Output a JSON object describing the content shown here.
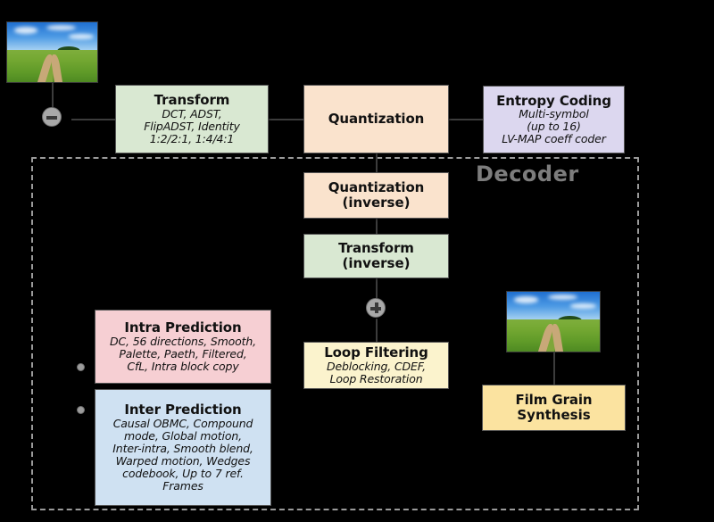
{
  "diagram": {
    "region_label": "Decoder",
    "nodes": [
      {
        "id": "transform",
        "title": "Transform",
        "sub": "DCT, ADST,\nFlipADST, Identity\n1:2/2:1, 1:4/4:1",
        "color": "#d9e8d2"
      },
      {
        "id": "quantization",
        "title": "Quantization",
        "sub": "",
        "color": "#fae3cd"
      },
      {
        "id": "entropy-coding",
        "title": "Entropy Coding",
        "sub": "Multi-symbol\n(up to 16)\nLV-MAP coeff coder",
        "color": "#dcd7ef"
      },
      {
        "id": "quantization-inverse",
        "title": "Quantization",
        "title2": "(inverse)",
        "sub": "",
        "color": "#fae3cd"
      },
      {
        "id": "transform-inverse",
        "title": "Transform",
        "title2": "(inverse)",
        "sub": "",
        "color": "#d9e8d2"
      },
      {
        "id": "intra-prediction",
        "title": "Intra Prediction",
        "sub": "DC, 56 directions, Smooth,\nPalette, Paeth, Filtered,\nCfL, Intra block copy",
        "color": "#f6cfd3"
      },
      {
        "id": "inter-prediction",
        "title": "Inter Prediction",
        "sub": "Causal OBMC, Compound\nmode, Global motion,\nInter-intra, Smooth blend,\nWarped motion, Wedges\ncodebook, Up to 7 ref.\nFrames",
        "color": "#cfe1f2"
      },
      {
        "id": "loop-filtering",
        "title": "Loop Filtering",
        "sub": "Deblocking, CDEF,\nLoop Restoration",
        "color": "#fbf3cd"
      },
      {
        "id": "film-grain-synthesis",
        "title": "Film Grain",
        "title2": "Synthesis",
        "sub": "",
        "color": "#fbe3a0"
      }
    ],
    "operators": [
      {
        "id": "subtract",
        "symbol": "minus"
      },
      {
        "id": "add",
        "symbol": "plus"
      }
    ],
    "thumbnails": [
      {
        "id": "source-frame-thumbnail",
        "alt": "landscape photo with dirt path through green field"
      },
      {
        "id": "output-frame-thumbnail",
        "alt": "landscape photo with dirt path through green field"
      }
    ],
    "colors": {
      "background": "#000000",
      "region_border": "#9a9a9a",
      "region_label": "#7d7d7d",
      "node_border": "#555555",
      "connector": "#3c3c3c",
      "operator_fill": "#a8a8a8"
    }
  }
}
